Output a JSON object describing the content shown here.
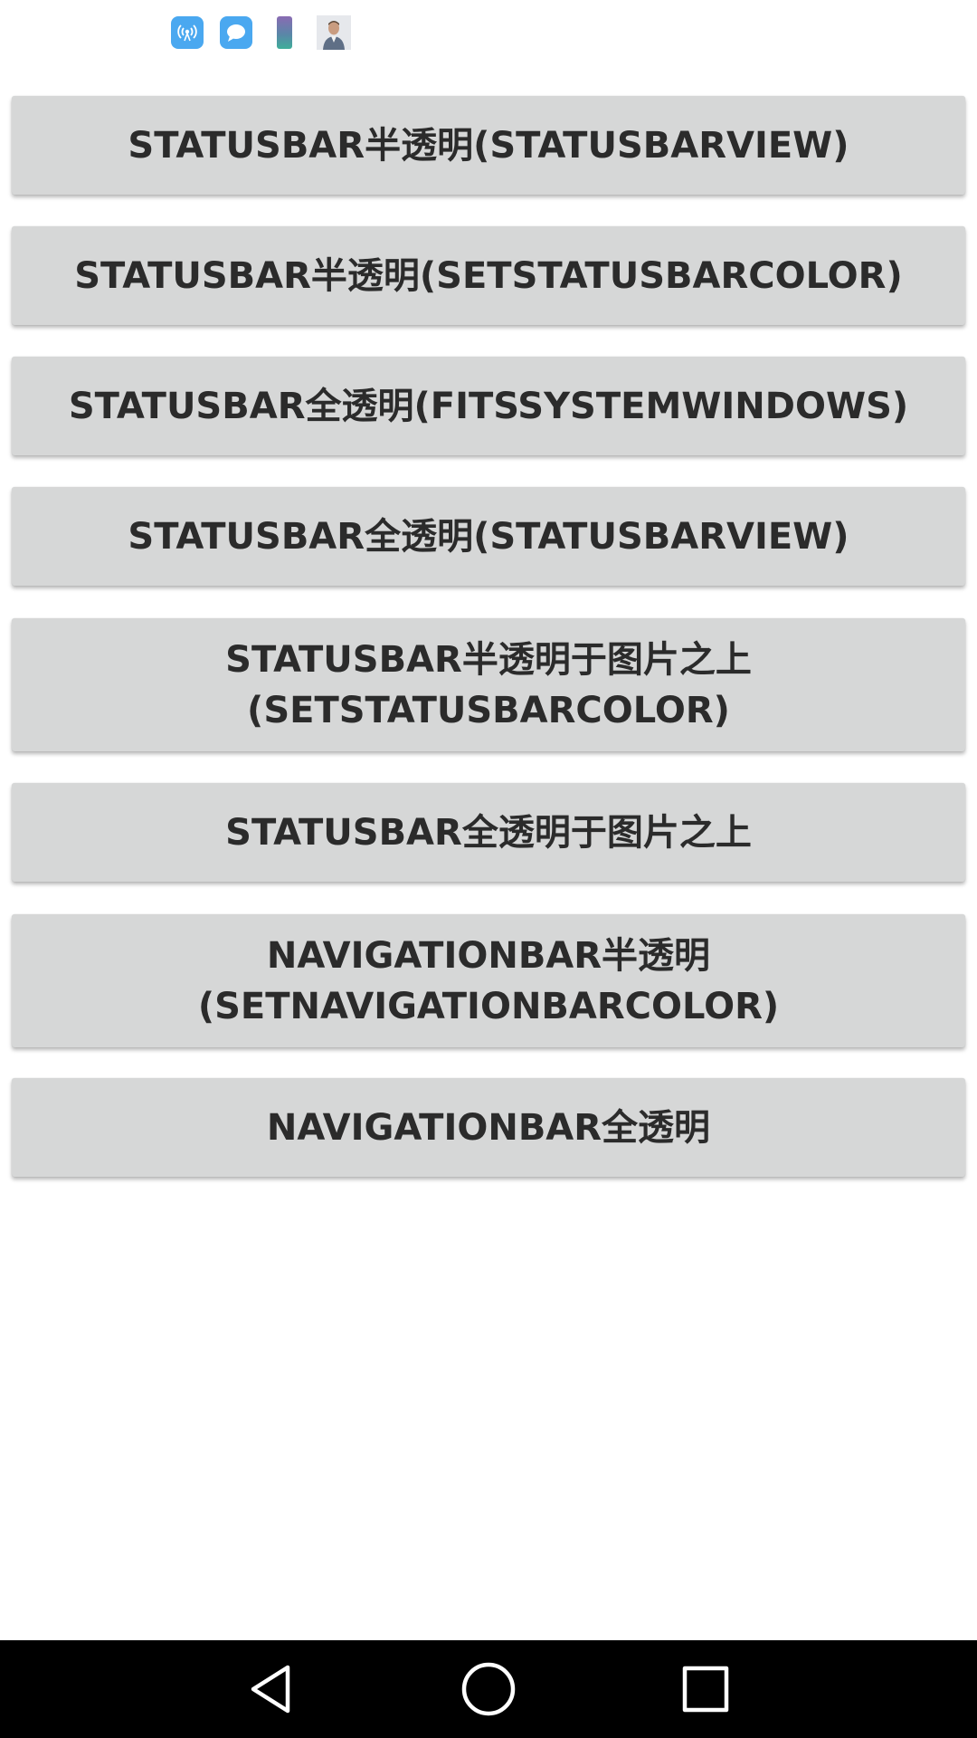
{
  "status_bar": {
    "icons": [
      {
        "name": "wifi-hotspot-icon",
        "color": "#4aa8f0"
      },
      {
        "name": "message-icon",
        "color": "#4aa8f0"
      },
      {
        "name": "phone-icon"
      },
      {
        "name": "avatar-icon"
      }
    ]
  },
  "buttons": [
    {
      "label": "STATUSBAR半透明(STATUSBARVIEW)"
    },
    {
      "label": "STATUSBAR半透明(SETSTATUSBARCOLOR)"
    },
    {
      "label": "STATUSBAR全透明(FITSSYSTEMWINDOWS)"
    },
    {
      "label": "STATUSBAR全透明(STATUSBARVIEW)"
    },
    {
      "label": "STATUSBAR半透明于图片之上\n(SETSTATUSBARCOLOR)"
    },
    {
      "label": "STATUSBAR全透明于图片之上"
    },
    {
      "label": "NAVIGATIONBAR半透明\n(SETNAVIGATIONBARCOLOR)"
    },
    {
      "label": "NAVIGATIONBAR全透明"
    }
  ],
  "nav_bar": {
    "items": [
      {
        "icon": "back-icon"
      },
      {
        "icon": "home-icon"
      },
      {
        "icon": "recent-apps-icon"
      }
    ]
  },
  "colors": {
    "button_bg": "#d6d7d7",
    "button_text": "#2b2b2b",
    "nav_bar_bg": "#000000",
    "page_bg": "#ffffff"
  }
}
